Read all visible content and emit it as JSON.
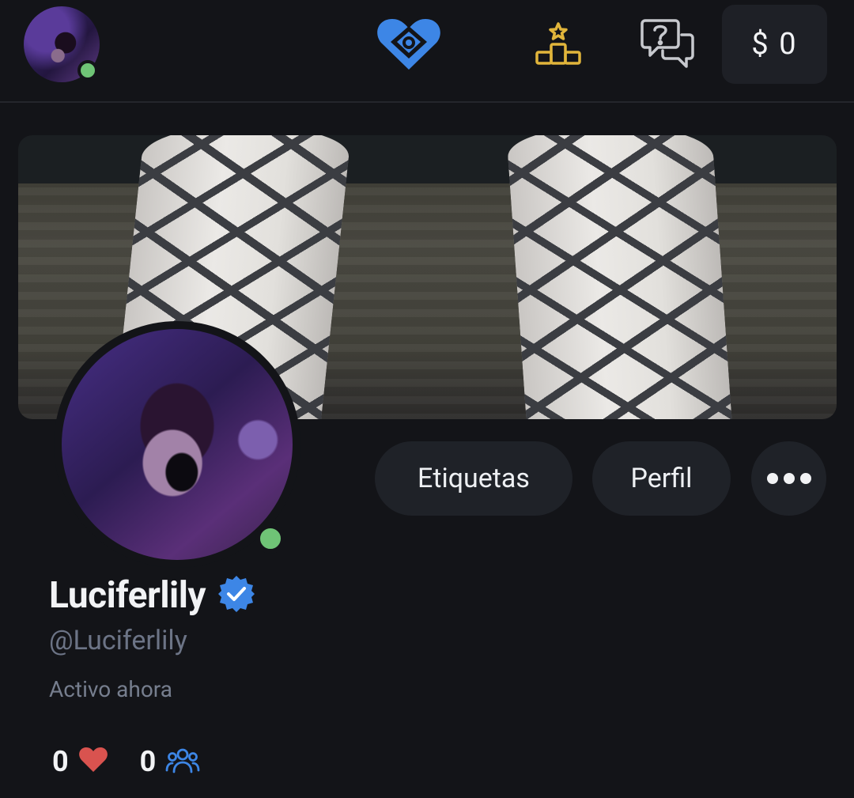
{
  "header": {
    "wallet_label": "$ 0",
    "icons": [
      "logo-heart-icon",
      "leaderboard-icon",
      "chat-questions-icon"
    ],
    "colors": {
      "heart": "#3d86e6",
      "podium": "#e1b53b",
      "chat": "#c7c9ce",
      "online": "#6fc476"
    }
  },
  "profile": {
    "display_name": "Luciferlily",
    "handle": "@Luciferlily",
    "status": "Activo ahora",
    "verified": true
  },
  "actions": {
    "tags_label": "Etiquetas",
    "profile_label": "Perfil",
    "more_label": "more"
  },
  "stats": {
    "likes": "0",
    "followers": "0",
    "colors": {
      "like": "#d9534f",
      "followers": "#3d86e6"
    }
  }
}
